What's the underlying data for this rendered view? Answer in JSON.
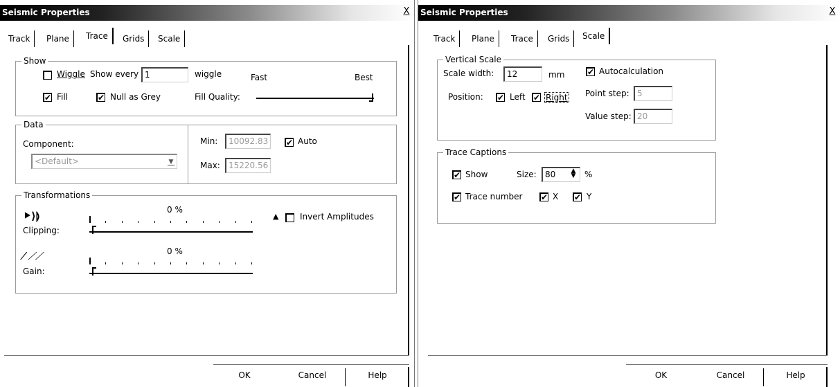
{
  "left_dialog": {
    "title": "Seismic Properties",
    "close": "X",
    "tabs": [
      "Track",
      "Plane",
      "Trace",
      "Grids",
      "Scale"
    ],
    "active_tab": "Trace",
    "show": {
      "legend": "Show",
      "wiggle_label": "Wiggle",
      "show_every_label": "Show every",
      "show_every_value": "1",
      "wiggle_suffix": "wiggle",
      "fast_label": "Fast",
      "best_label": "Best",
      "fill_label": "Fill",
      "null_grey_label": "Null as Grey",
      "fill_quality_label": "Fill Quality:",
      "fill_quality_level": 1.0
    },
    "data": {
      "legend": "Data",
      "component_label": "Component:",
      "component_value": "<Default>",
      "min_label": "Min:",
      "min_value": "10092.83",
      "max_label": "Max:",
      "max_value": "15220.56",
      "auto_label": "Auto"
    },
    "transformations": {
      "legend": "Transformations",
      "clipping_label": "Clipping:",
      "clipping_value": "0 %",
      "gain_label": "Gain:",
      "gain_value": "0 %",
      "invert_label": "Invert Amplitudes"
    },
    "buttons": {
      "ok": "OK",
      "cancel": "Cancel",
      "help": "Help"
    }
  },
  "right_dialog": {
    "title": "Seismic Properties",
    "close": "X",
    "tabs": [
      "Track",
      "Plane",
      "Trace",
      "Grids",
      "Scale"
    ],
    "active_tab": "Scale",
    "vertical_scale": {
      "legend": "Vertical Scale",
      "scale_width_label": "Scale width:",
      "scale_width_value": "12",
      "unit": "mm",
      "autocalc_label": "Autocalculation",
      "position_label": "Position:",
      "left_label": "Left",
      "right_label": "Right",
      "point_step_label": "Point step:",
      "point_step_value": "5",
      "value_step_label": "Value step:",
      "value_step_value": "20"
    },
    "trace_captions": {
      "legend": "Trace Captions",
      "show_label": "Show",
      "size_label": "Size:",
      "size_value": "80",
      "percent": "%",
      "trace_number_label": "Trace number",
      "x_label": "X",
      "y_label": "Y"
    },
    "buttons": {
      "ok": "OK",
      "cancel": "Cancel",
      "help": "Help"
    }
  },
  "checkmark": "✔"
}
